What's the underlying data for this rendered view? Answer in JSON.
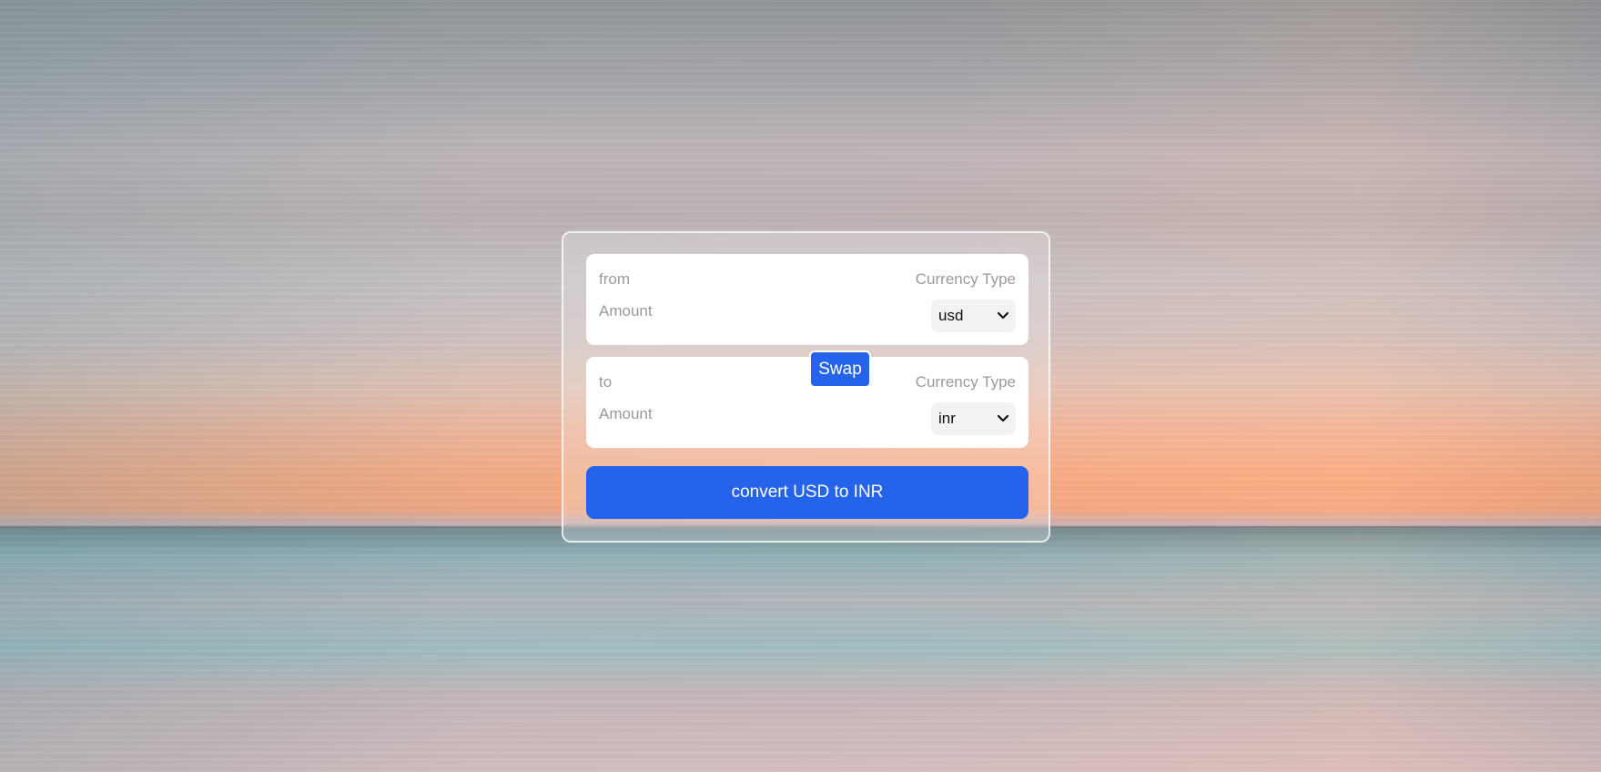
{
  "from_panel": {
    "label": "from",
    "amount_placeholder": "Amount",
    "currency_type_label": "Currency Type",
    "selected_currency": "usd"
  },
  "to_panel": {
    "label": "to",
    "amount_placeholder": "Amount",
    "currency_type_label": "Currency Type",
    "selected_currency": "inr"
  },
  "swap_button": {
    "label": "Swap"
  },
  "convert_button": {
    "label": "convert USD to INR"
  },
  "colors": {
    "accent": "#2563eb",
    "panel_bg": "#ffffff",
    "muted_text": "#9a9a9a",
    "select_bg": "#f2f2f4"
  },
  "icons": {
    "select_arrow": "chevron-down-icon"
  }
}
